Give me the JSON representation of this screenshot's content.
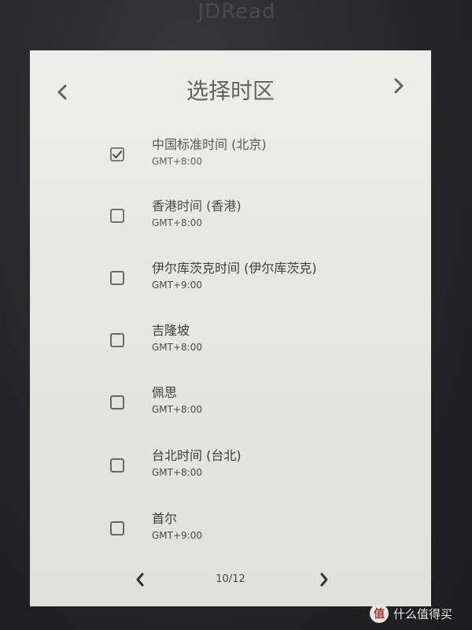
{
  "device": {
    "brand": "JDRead"
  },
  "header": {
    "title": "选择时区",
    "prev_icon": "chevron-left-icon",
    "next_icon": "chevron-right-icon"
  },
  "timezones": [
    {
      "label": "中国标准时间 (北京)",
      "offset": "GMT+8:00",
      "checked": true
    },
    {
      "label": "香港时间 (香港)",
      "offset": "GMT+8:00",
      "checked": false
    },
    {
      "label": "伊尔库茨克时间 (伊尔库茨克)",
      "offset": "GMT+9:00",
      "checked": false
    },
    {
      "label": "吉隆坡",
      "offset": "GMT+8:00",
      "checked": false
    },
    {
      "label": "佩思",
      "offset": "GMT+8:00",
      "checked": false
    },
    {
      "label": "台北时间 (台北)",
      "offset": "GMT+8:00",
      "checked": false
    },
    {
      "label": "首尔",
      "offset": "GMT+9:00",
      "checked": false
    }
  ],
  "pager": {
    "page": "10/12",
    "prev_icon": "chevron-left-icon",
    "next_icon": "chevron-right-icon"
  },
  "watermark": {
    "badge": "值",
    "text": "什么值得买"
  }
}
